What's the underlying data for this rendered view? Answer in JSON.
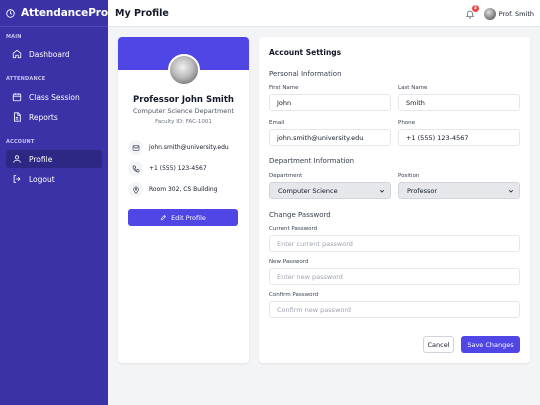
{
  "app": {
    "brand": "AttendancePro"
  },
  "sidebar": {
    "sections": [
      {
        "label": "MAIN",
        "items": [
          {
            "label": "Dashboard",
            "icon": "home-icon"
          }
        ]
      },
      {
        "label": "ATTENDANCE",
        "items": [
          {
            "label": "Class Session",
            "icon": "calendar-icon"
          },
          {
            "label": "Reports",
            "icon": "document-icon"
          }
        ]
      },
      {
        "label": "ACCOUNT",
        "items": [
          {
            "label": "Profile",
            "icon": "user-icon",
            "active": true
          },
          {
            "label": "Logout",
            "icon": "logout-icon"
          }
        ]
      }
    ]
  },
  "header": {
    "title": "My Profile",
    "notification_count": "3",
    "user_name": "Prof. Smith"
  },
  "profile": {
    "name": "Professor John Smith",
    "department": "Computer Science Department",
    "faculty_id": "Faculty ID: FAC-1001",
    "email": "john.smith@university.edu",
    "phone": "+1 (555) 123-4567",
    "office": "Room 302, CS Building",
    "edit_label": "Edit Profile"
  },
  "settings": {
    "title": "Account Settings",
    "personal_title": "Personal Information",
    "first_name_label": "First Name",
    "first_name_value": "John",
    "last_name_label": "Last Name",
    "last_name_value": "Smith",
    "email_label": "Email",
    "email_value": "john.smith@university.edu",
    "phone_label": "Phone",
    "phone_value": "+1 (555) 123-4567",
    "dept_title": "Department Information",
    "department_label": "Department",
    "department_value": "Computer Science",
    "position_label": "Position",
    "position_value": "Professor",
    "password_title": "Change Password",
    "current_label": "Current Password",
    "current_placeholder": "Enter current password",
    "new_label": "New Password",
    "new_placeholder": "Enter new password",
    "confirm_label": "Confirm Password",
    "confirm_placeholder": "Confirm new password",
    "cancel_label": "Cancel",
    "save_label": "Save Changes"
  },
  "colors": {
    "sidebar": "#3b32a8",
    "accent": "#4f46e5",
    "badge": "#ef4444"
  }
}
